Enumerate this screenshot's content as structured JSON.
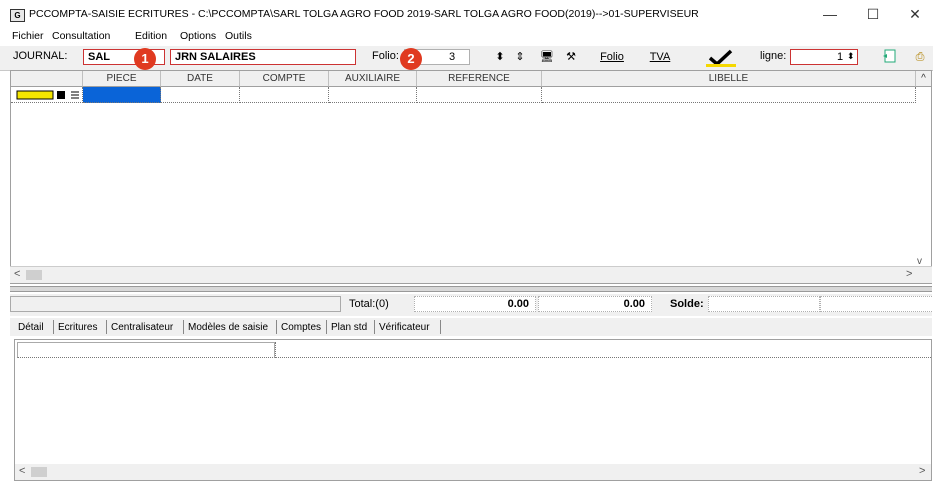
{
  "window": {
    "title": "PCCOMPTA-SAISIE ECRITURES - C:\\PCCOMPTA\\SARL TOLGA AGRO FOOD 2019-SARL TOLGA  AGRO FOOD(2019)-->01-SUPERVISEUR",
    "icon_text": "G",
    "min_label": "—",
    "max_label": "☐",
    "close_label": "✕"
  },
  "menu": [
    "Fichier",
    "Consultation",
    "Edition",
    "Options",
    "Outils"
  ],
  "toolbar": {
    "journal_label": "JOURNAL:",
    "journal_code": "SAL",
    "journal_name": "JRN SALAIRES",
    "folio_label": "Folio:",
    "folio_value": "3",
    "folio_button": "Folio",
    "tva_button": "TVA",
    "ligne_label": "ligne:",
    "ligne_value": "1",
    "badge1": "1",
    "badge2": "2"
  },
  "grid": {
    "columns": [
      "PIECE",
      "DATE",
      "COMPTE",
      "AUXILIAIRE",
      "REFERENCE",
      "LIBELLE"
    ]
  },
  "totals": {
    "total_label": "Total:(0)",
    "debit": "0.00",
    "credit": "0.00",
    "solde_label": "Solde:"
  },
  "tabs": [
    "Détail",
    "Ecritures",
    "Centralisateur",
    "Modèles de saisie",
    "Comptes",
    "Plan std",
    "Vérificateur"
  ],
  "colors": {
    "badge": "#e03a20",
    "selected_cell": "#0a64d8",
    "check": "#f5d800"
  }
}
